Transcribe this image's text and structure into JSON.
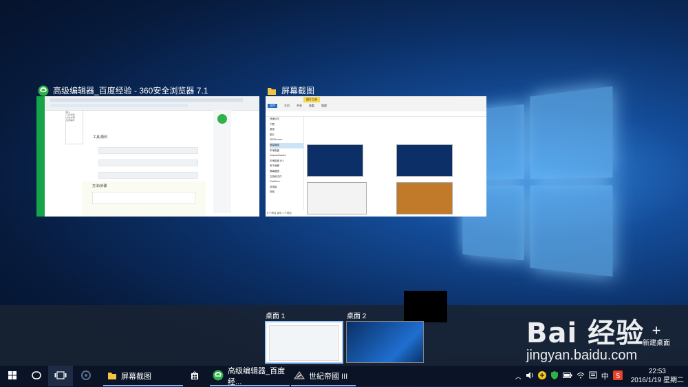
{
  "windows": [
    {
      "title": "高级编辑器_百度经验 - 360安全浏览器 7.1",
      "icon": "360-browser-icon"
    },
    {
      "title": "屏幕截图",
      "icon": "folder-icon"
    }
  ],
  "explorer_thumb": {
    "ribbon_tab_active": "图片工具",
    "tabs": [
      "文件",
      "主页",
      "共享",
      "查看",
      "管理"
    ],
    "nav_items": [
      "快速访问",
      "下载",
      "桌面",
      "图片",
      "360Chrome",
      "屏幕截图",
      "本地磁盘",
      "XuanaoGames",
      "本地磁盘 (E:)",
      "电子画廊",
      "屏幕截图",
      "文档和文件",
      "OneDrive",
      "此电脑",
      "网络"
    ],
    "status": "8 个项目   选中 1 个项目"
  },
  "browser_thumb": {
    "menu_items": [
      "插入",
      "工具/原料",
      "方法/步骤",
      "注意事项"
    ],
    "section1": "工具/原料",
    "section2": "方法/步骤"
  },
  "desktops": [
    {
      "label": "桌面 1",
      "active": true
    },
    {
      "label": "桌面 2",
      "active": false
    }
  ],
  "new_desktop": {
    "symbol": "+",
    "label": "新建桌面"
  },
  "taskbar": {
    "items": [
      {
        "label": "屏幕截图",
        "icon": "folder-icon"
      },
      {
        "label": "高级编辑器_百度经...",
        "icon": "360-browser-icon"
      },
      {
        "label": "世紀帝國 III",
        "icon": "age-of-empires-icon"
      }
    ],
    "tray": {
      "ime": "中",
      "time": "22:53",
      "date": "2016/1/19 星期二"
    }
  },
  "watermark": {
    "main": "Bai 经验",
    "sub": "jingyan.baidu.com"
  },
  "colors": {
    "taskbar": "#0a1426",
    "accent": "#7fb4f5",
    "browser_green": "#16a34a",
    "folder": "#f5c242"
  }
}
